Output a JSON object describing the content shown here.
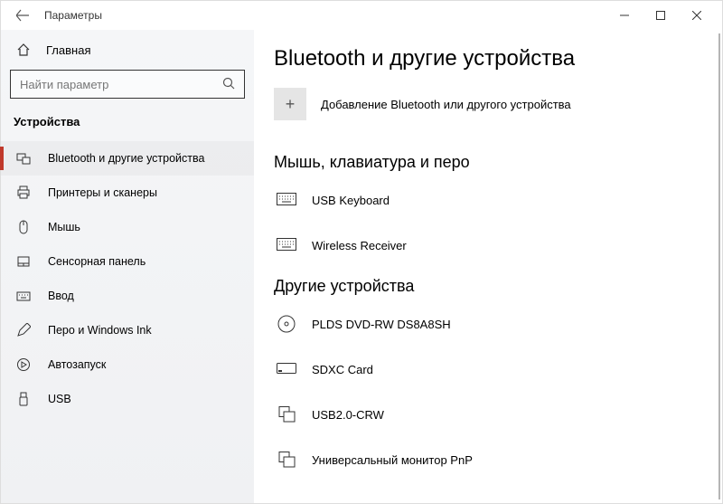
{
  "window": {
    "title": "Параметры"
  },
  "sidebar": {
    "home": "Главная",
    "search_placeholder": "Найти параметр",
    "section": "Устройства",
    "items": [
      {
        "label": "Bluetooth и другие устройства"
      },
      {
        "label": "Принтеры и сканеры"
      },
      {
        "label": "Мышь"
      },
      {
        "label": "Сенсорная панель"
      },
      {
        "label": "Ввод"
      },
      {
        "label": "Перо и Windows Ink"
      },
      {
        "label": "Автозапуск"
      },
      {
        "label": "USB"
      }
    ]
  },
  "main": {
    "title": "Bluetooth и другие устройства",
    "add_label": "Добавление Bluetooth или другого устройства",
    "group1_title": "Мышь, клавиатура и перо",
    "group1": [
      {
        "label": "USB Keyboard"
      },
      {
        "label": "Wireless Receiver"
      }
    ],
    "group2_title": "Другие устройства",
    "group2": [
      {
        "label": "PLDS DVD-RW DS8A8SH"
      },
      {
        "label": "SDXC Card"
      },
      {
        "label": "USB2.0-CRW"
      },
      {
        "label": "Универсальный монитор PnP"
      }
    ]
  }
}
